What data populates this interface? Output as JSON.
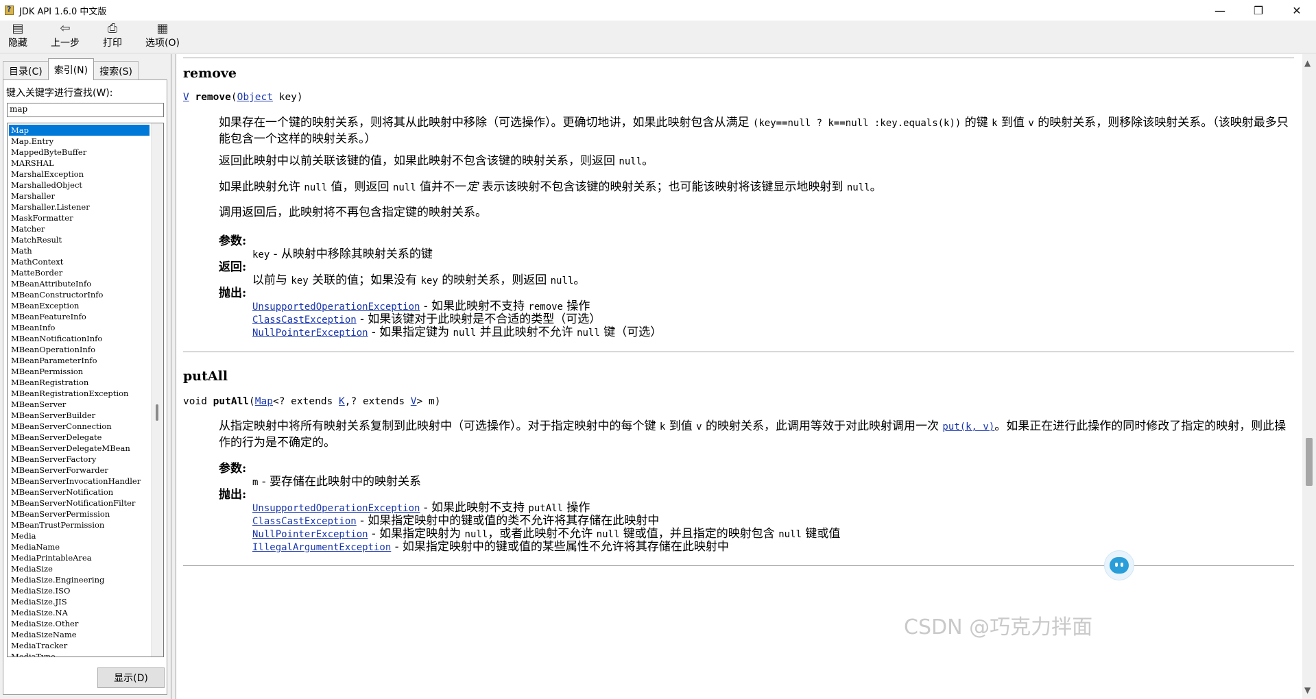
{
  "window": {
    "title": "JDK API 1.6.0 中文版",
    "controls": [
      "—",
      "❐",
      "✕"
    ]
  },
  "toolbar": {
    "hide": "隐藏",
    "back": "上一步",
    "print": "打印",
    "options": "选项(O)"
  },
  "left": {
    "tabs": [
      "目录(C)",
      "索引(N)",
      "搜索(S)"
    ],
    "active_tab": "索引(N)",
    "search_label": "键入关键字进行查找(W):",
    "search_value": "map",
    "display_button": "显示(D)",
    "items": [
      "Map",
      "Map.Entry",
      "MappedByteBuffer",
      "MARSHAL",
      "MarshalException",
      "MarshalledObject",
      "Marshaller",
      "Marshaller.Listener",
      "MaskFormatter",
      "Matcher",
      "MatchResult",
      "Math",
      "MathContext",
      "MatteBorder",
      "MBeanAttributeInfo",
      "MBeanConstructorInfo",
      "MBeanException",
      "MBeanFeatureInfo",
      "MBeanInfo",
      "MBeanNotificationInfo",
      "MBeanOperationInfo",
      "MBeanParameterInfo",
      "MBeanPermission",
      "MBeanRegistration",
      "MBeanRegistrationException",
      "MBeanServer",
      "MBeanServerBuilder",
      "MBeanServerConnection",
      "MBeanServerDelegate",
      "MBeanServerDelegateMBean",
      "MBeanServerFactory",
      "MBeanServerForwarder",
      "MBeanServerInvocationHandler",
      "MBeanServerNotification",
      "MBeanServerNotificationFilter",
      "MBeanServerPermission",
      "MBeanTrustPermission",
      "Media",
      "MediaName",
      "MediaPrintableArea",
      "MediaSize",
      "MediaSize.Engineering",
      "MediaSize.ISO",
      "MediaSize.JIS",
      "MediaSize.NA",
      "MediaSize.Other",
      "MediaSizeName",
      "MediaTracker",
      "MediaType"
    ]
  },
  "remove": {
    "heading": "remove",
    "sig_return": "V",
    "sig_name": "remove",
    "sig_paren": "(",
    "sig_param_type": "Object",
    "sig_rest": " key)",
    "p1a": "如果存在一个键的映射关系，则将其从此映射中移除（可选操作）。更确切地讲，如果此映射包含从满足 ",
    "p1code": "(key==null ? k==null :key.equals(k))",
    "p1b": " 的键 ",
    "p1k": "k",
    "p1c": " 到值 ",
    "p1v": "v",
    "p1d": " 的映射关系，则移除该映射关系。（该映射最多只能包含一个这样的映射关系。）",
    "p2a": "返回此映射中以前关联该键的值，如果此映射不包含该键的映射关系，则返回 ",
    "p2code": "null",
    "p2b": "。",
    "p3a": "如果此映射允许 ",
    "p3c1": "null",
    "p3b": " 值，则返回 ",
    "p3c2": "null",
    "p3c": " 值并不一",
    "p3d": "定",
    "p3e": " 表示该映射不包含该键的映射关系；也可能该映射将该键显示地映射到 ",
    "p3c3": "null",
    "p3f": "。",
    "p4": "调用返回后，此映射将不再包含指定键的映射关系。",
    "params_label": "参数:",
    "param_name": "key",
    "param_desc": " - 从映射中移除其映射关系的键",
    "returns_label": "返回:",
    "ret_a": "以前与 ",
    "ret_code": "key",
    "ret_b": " 关联的值；如果没有 ",
    "ret_code2": "key",
    "ret_c": " 的映射关系，则返回 ",
    "ret_code3": "null",
    "ret_d": "。",
    "throws_label": "抛出:",
    "t1": "UnsupportedOperationException",
    "t1d_a": " - 如果此映射不支持 ",
    "t1d_code": "remove",
    "t1d_b": " 操作",
    "t2": "ClassCastException",
    "t2d": " - 如果该键对于此映射是不合适的类型（可选）",
    "t3": "NullPointerException",
    "t3d_a": " - 如果指定键为 ",
    "t3d_c1": "null",
    "t3d_b": " 并且此映射不允许 ",
    "t3d_c2": "null",
    "t3d_c": " 键（可选）"
  },
  "putall": {
    "heading": "putAll",
    "sig_void": "void ",
    "sig_name": "putAll",
    "sig_open": "(",
    "sig_map": "Map",
    "sig_mid1": "<? extends ",
    "sig_k": "K",
    "sig_mid2": ",? extends ",
    "sig_v": "V",
    "sig_end": "> m)",
    "p1a": "从指定映射中将所有映射关系复制到此映射中（可选操作）。对于指定映射中的每个键 ",
    "p1k": "k",
    "p1b": " 到值 ",
    "p1v": "v",
    "p1c": " 的映射关系，此调用等效于对此映射调用一次 ",
    "p1link": "put(k, v)",
    "p1d": "。如果正在进行此操作的同时修改了指定的映射，则此操作的行为是不确定的。",
    "params_label": "参数:",
    "param_name": "m",
    "param_desc": " - 要存储在此映射中的映射关系",
    "throws_label": "抛出:",
    "t1": "UnsupportedOperationException",
    "t1d_a": " - 如果此映射不支持 ",
    "t1d_code": "putAll",
    "t1d_b": " 操作",
    "t2": "ClassCastException",
    "t2d": " - 如果指定映射中的键或值的类不允许将其存储在此映射中",
    "t3": "NullPointerException",
    "t3d_a": " - 如果指定映射为 ",
    "t3d_c1": "null",
    "t3d_b": "，或者此映射不允许 ",
    "t3d_c2": "null",
    "t3d_c": " 键或值，并且指定的映射包含 ",
    "t3d_c3": "null",
    "t3d_d": " 键或值",
    "t4": "IllegalArgumentException",
    "t4d": " - 如果指定映射中的键或值的某些属性不允许将其存储在此映射中"
  },
  "watermark": "CSDN @巧克力拌面",
  "colors": {
    "link": "#1a37b0",
    "selection": "#0078d7"
  }
}
